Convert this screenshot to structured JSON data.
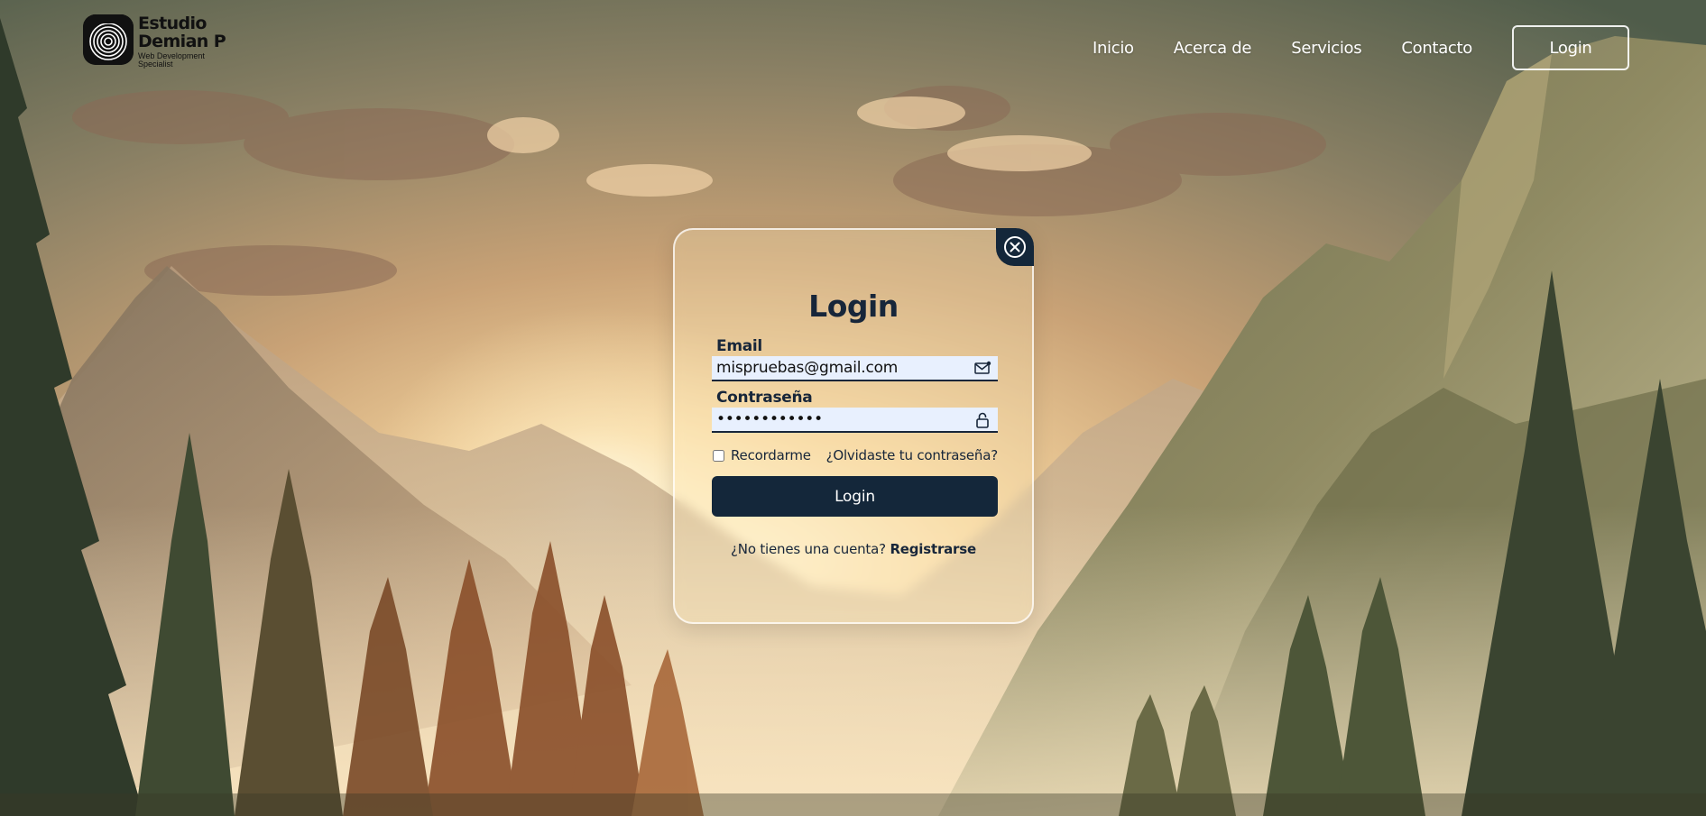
{
  "brand": {
    "name_line1": "Estudio",
    "name_line2": "Demian P",
    "tagline_line1": "Web Development",
    "tagline_line2": "Specialist",
    "logo_icon": "fingerprint-logo-icon"
  },
  "nav": {
    "items": [
      {
        "label": "Inicio"
      },
      {
        "label": "Acerca de"
      },
      {
        "label": "Servicios"
      },
      {
        "label": "Contacto"
      }
    ],
    "login_label": "Login"
  },
  "modal": {
    "title": "Login",
    "close_icon": "close-circle-icon",
    "email": {
      "label": "Email",
      "value": "mispruebas@gmail.com",
      "icon": "mail-icon"
    },
    "password": {
      "label": "Contraseña",
      "value": "••••••••••••",
      "icon": "lock-icon"
    },
    "remember_label": "Recordarme",
    "remember_checked": false,
    "forgot_label": "¿Olvidaste tu contraseña?",
    "submit_label": "Login",
    "no_account_text": "¿No tienes una cuenta?",
    "register_label": "Registrarse"
  },
  "colors": {
    "primary_dark": "#14273a",
    "input_bg": "#e8f0fe",
    "text": "#17263a"
  }
}
